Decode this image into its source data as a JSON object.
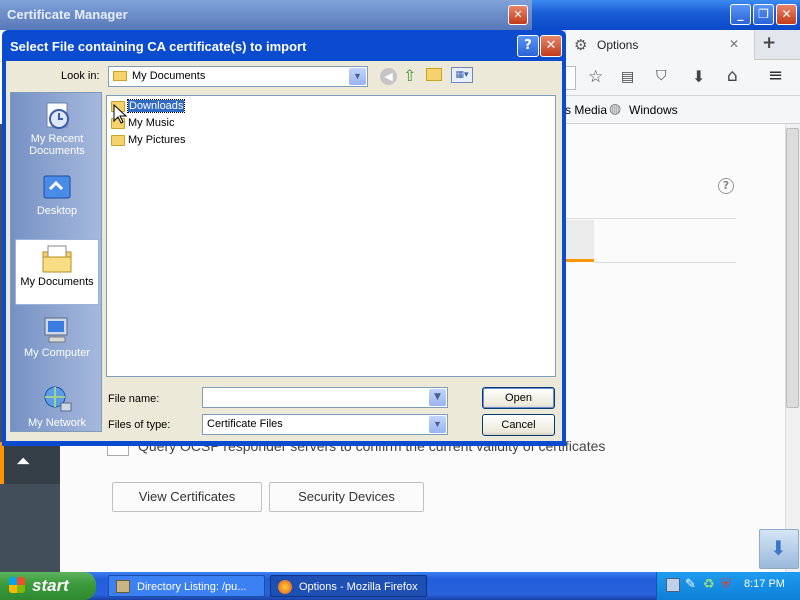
{
  "certificate_manager": {
    "title": "Certificate Manager",
    "close_label": "✕"
  },
  "firefox": {
    "window_buttons": {
      "minimize": "_",
      "maximize": "❐",
      "close": "✕"
    },
    "tab": {
      "label": "Options",
      "close": "✕",
      "new_tab": "+"
    },
    "bookmarks": [
      "s Media",
      "Windows"
    ],
    "partial_tab_text": "s",
    "help": "?",
    "ocsp_text": "Query OCSP responder servers to confirm the current validity of certificates",
    "view_certificates_button": "View Certificates",
    "security_devices_button": "Security Devices"
  },
  "dialog": {
    "title": "Select File containing CA certificate(s) to import",
    "help_btn": "?",
    "close_btn": "✕",
    "look_in_label": "Look in:",
    "look_in_value": "My Documents",
    "places": [
      {
        "label": "My Recent Documents",
        "icon": "recent-documents-icon"
      },
      {
        "label": "Desktop",
        "icon": "desktop-icon"
      },
      {
        "label": "My Documents",
        "icon": "my-documents-icon",
        "selected": true
      },
      {
        "label": "My Computer",
        "icon": "my-computer-icon"
      },
      {
        "label": "My Network",
        "icon": "my-network-icon"
      }
    ],
    "files": [
      {
        "name": "Downloads",
        "selected": true
      },
      {
        "name": "My Music"
      },
      {
        "name": "My Pictures"
      }
    ],
    "file_name_label": "File name:",
    "file_name_value": "",
    "files_of_type_label": "Files of type:",
    "files_of_type_value": "Certificate Files",
    "open_button": "Open",
    "cancel_button": "Cancel"
  },
  "taskbar": {
    "start_label": "start",
    "tasks": [
      {
        "label": "Directory Listing: /pu..."
      },
      {
        "label": "Options - Mozilla Firefox"
      }
    ],
    "clock": "8:17 PM"
  },
  "colors": {
    "accent": "#ff9500",
    "xp_blue": "#0a4bd0",
    "selection": "#316ac5"
  }
}
